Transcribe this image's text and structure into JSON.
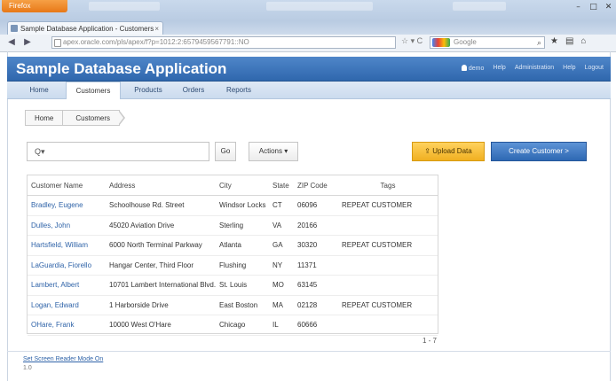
{
  "browser": {
    "app_badge": "Firefox",
    "tab_title": "Sample Database Application - Customers",
    "tab_close": "×",
    "url": "apex.oracle.com/pls/apex/f?p=1012:2:6579459567791::NO",
    "search_engine": "Google",
    "window_controls": [
      "–",
      "□",
      "✕"
    ],
    "nav_back": "◀",
    "nav_forward": "▶",
    "url_icons": "☆ ▾ C",
    "toolbar_icons": [
      "⌕",
      "★",
      "▤",
      "⌂"
    ]
  },
  "header": {
    "title": "Sample Database Application",
    "links": [
      "demo",
      "Help",
      "Administration",
      "Help",
      "Logout"
    ]
  },
  "menu": {
    "items": [
      {
        "label": "Home",
        "active": false
      },
      {
        "label": "Customers",
        "active": true
      },
      {
        "label": "Products",
        "active": false
      },
      {
        "label": "Orders",
        "active": false
      },
      {
        "label": "Reports",
        "active": false
      }
    ]
  },
  "breadcrumb": [
    "Home",
    "Customers"
  ],
  "toolbar": {
    "search_value": "Q▾",
    "go_label": "Go",
    "actions_label": "Actions ▾",
    "upload_label": "⇪ Upload Data",
    "create_label": "Create Customer >"
  },
  "table": {
    "headers": [
      "Customer Name",
      "Address",
      "City",
      "State",
      "ZIP Code",
      "Tags"
    ],
    "rows": [
      [
        "Bradley, Eugene",
        "Schoolhouse Rd. Street",
        "Windsor Locks",
        "CT",
        "06096",
        "REPEAT CUSTOMER"
      ],
      [
        "Dulles, John",
        "45020 Aviation Drive",
        "Sterling",
        "VA",
        "20166",
        ""
      ],
      [
        "Hartsfield, William",
        "6000 North Terminal Parkway",
        "Atlanta",
        "GA",
        "30320",
        "REPEAT CUSTOMER"
      ],
      [
        "LaGuardia, Fiorello",
        "Hangar Center, Third Floor",
        "Flushing",
        "NY",
        "11371",
        ""
      ],
      [
        "Lambert, Albert",
        "10701 Lambert International Blvd.",
        "St. Louis",
        "MO",
        "63145",
        ""
      ],
      [
        "Logan, Edward",
        "1 Harborside Drive",
        "East Boston",
        "MA",
        "02128",
        "REPEAT CUSTOMER"
      ],
      [
        "OHare, Frank",
        "10000 West O'Hare",
        "Chicago",
        "IL",
        "60666",
        ""
      ]
    ],
    "pagination": "1 - 7"
  },
  "footer": {
    "link": "Set Screen Reader Mode On",
    "version": "1.0"
  }
}
